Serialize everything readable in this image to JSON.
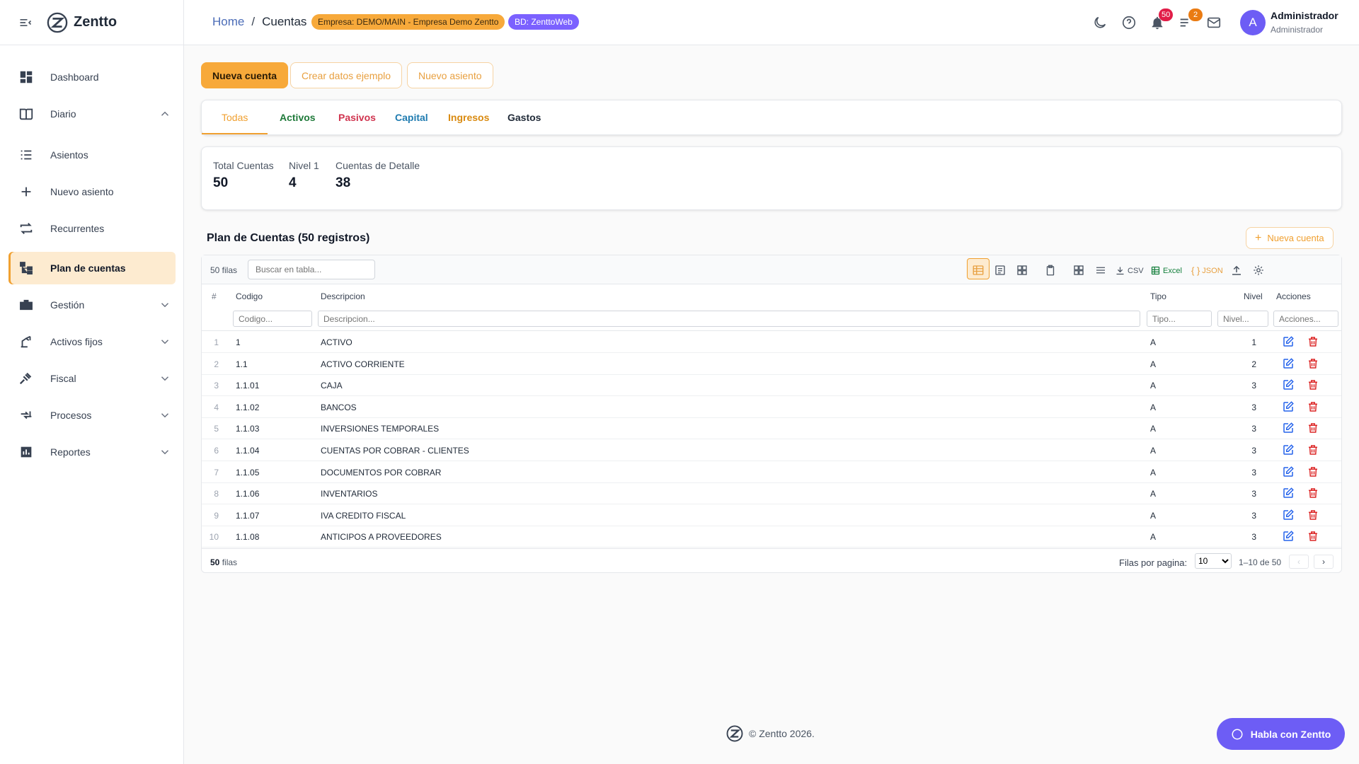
{
  "app": {
    "name": "Zentto"
  },
  "colors": {
    "accent": "#f7a93a",
    "purple": "#6d5df5",
    "edit": "#2563eb",
    "delete": "#dc2626"
  },
  "sidebar": {
    "items": [
      {
        "label": "Dashboard",
        "icon": "dashboard-icon"
      },
      {
        "label": "Diario",
        "icon": "book-icon",
        "expanded": true
      },
      {
        "label": "Asientos",
        "icon": "list-icon"
      },
      {
        "label": "Nuevo asiento",
        "icon": "plus-icon"
      },
      {
        "label": "Recurrentes",
        "icon": "repeat-icon"
      },
      {
        "label": "Plan de cuentas",
        "icon": "account-tree-icon",
        "active": true
      },
      {
        "label": "Gestión",
        "icon": "briefcase-icon"
      },
      {
        "label": "Activos fijos",
        "icon": "asset-icon"
      },
      {
        "label": "Fiscal",
        "icon": "gavel-icon"
      },
      {
        "label": "Procesos",
        "icon": "process-icon"
      },
      {
        "label": "Reportes",
        "icon": "chart-icon"
      }
    ]
  },
  "header": {
    "breadcrumb": {
      "home": "Home",
      "separator": "/",
      "current": "Cuentas"
    },
    "chip_empresa": "Empresa: DEMO/MAIN - Empresa Demo Zentto",
    "chip_bd": "BD: ZenttoWeb",
    "notifications_count": "50",
    "tasks_count": "2",
    "user": {
      "initial": "A",
      "name": "Administrador",
      "role": "Administrador"
    }
  },
  "actions": {
    "nueva_cuenta": "Nueva cuenta",
    "crear_datos": "Crear datos ejemplo",
    "nuevo_asiento": "Nuevo asiento"
  },
  "tabs": [
    {
      "label": "Todas",
      "color": "#f0a030",
      "selected": true
    },
    {
      "label": "Activos",
      "color": "#1f7a3a"
    },
    {
      "label": "Pasivos",
      "color": "#d0344f"
    },
    {
      "label": "Capital",
      "color": "#1f7bb0"
    },
    {
      "label": "Ingresos",
      "color": "#d98a10"
    },
    {
      "label": "Gastos",
      "color": "#1f2937"
    }
  ],
  "stats": [
    {
      "label": "Total Cuentas",
      "value": "50"
    },
    {
      "label": "Nivel 1",
      "value": "4"
    },
    {
      "label": "Cuentas de Detalle",
      "value": "38"
    }
  ],
  "table": {
    "title": "Plan de Cuentas (50 registros)",
    "new_button": "Nueva cuenta",
    "rows_count": "50 filas",
    "search_placeholder": "Buscar en tabla...",
    "toolbar": {
      "csv": "CSV",
      "excel": "Excel",
      "json": "JSON"
    },
    "columns": {
      "num": "#",
      "codigo": "Codigo",
      "descripcion": "Descripcion",
      "tipo": "Tipo",
      "nivel": "Nivel",
      "acciones": "Acciones"
    },
    "filters": {
      "codigo": "Codigo...",
      "descripcion": "Descripcion...",
      "tipo": "Tipo...",
      "nivel": "Nivel...",
      "acciones": "Acciones..."
    },
    "rows": [
      {
        "n": "1",
        "codigo": "1",
        "descripcion": "ACTIVO",
        "tipo": "A",
        "nivel": "1"
      },
      {
        "n": "2",
        "codigo": "1.1",
        "descripcion": "ACTIVO CORRIENTE",
        "tipo": "A",
        "nivel": "2"
      },
      {
        "n": "3",
        "codigo": "1.1.01",
        "descripcion": "CAJA",
        "tipo": "A",
        "nivel": "3"
      },
      {
        "n": "4",
        "codigo": "1.1.02",
        "descripcion": "BANCOS",
        "tipo": "A",
        "nivel": "3"
      },
      {
        "n": "5",
        "codigo": "1.1.03",
        "descripcion": "INVERSIONES TEMPORALES",
        "tipo": "A",
        "nivel": "3"
      },
      {
        "n": "6",
        "codigo": "1.1.04",
        "descripcion": "CUENTAS POR COBRAR - CLIENTES",
        "tipo": "A",
        "nivel": "3"
      },
      {
        "n": "7",
        "codigo": "1.1.05",
        "descripcion": "DOCUMENTOS POR COBRAR",
        "tipo": "A",
        "nivel": "3"
      },
      {
        "n": "8",
        "codigo": "1.1.06",
        "descripcion": "INVENTARIOS",
        "tipo": "A",
        "nivel": "3"
      },
      {
        "n": "9",
        "codigo": "1.1.07",
        "descripcion": "IVA CREDITO FISCAL",
        "tipo": "A",
        "nivel": "3"
      },
      {
        "n": "10",
        "codigo": "1.1.08",
        "descripcion": "ANTICIPOS A PROVEEDORES",
        "tipo": "A",
        "nivel": "3"
      }
    ],
    "footer": {
      "count_num": "50",
      "count_label": "filas",
      "per_page_label": "Filas por pagina:",
      "per_page": "10",
      "range": "1–10 de 50",
      "prev": "‹",
      "next": "›"
    }
  },
  "footer": {
    "copyright": "© Zentto 2026."
  },
  "chat": {
    "label": "Habla con Zentto"
  }
}
